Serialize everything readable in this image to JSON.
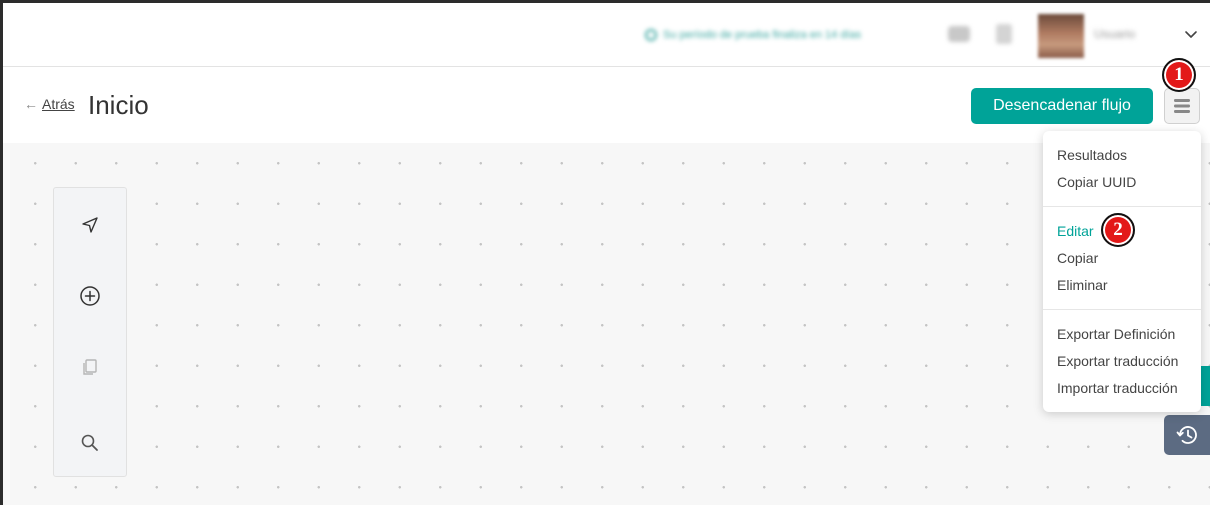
{
  "header": {
    "trial_banner_text": "Su período de prueba finaliza en 14 días",
    "user_name": "Usuario",
    "icons": [
      "info-icon",
      "help-icon",
      "bell-icon",
      "chevron-down-icon"
    ]
  },
  "titlebar": {
    "back_arrow": "←",
    "back_label": "Atrás",
    "page_title": "Inicio",
    "trigger_button_label": "Desencadenar flujo",
    "menu_icon": "hamburger-icon"
  },
  "toolbar": {
    "tools": [
      "navigate-icon",
      "add-circle-icon",
      "copy-icon",
      "search-icon"
    ]
  },
  "menu": {
    "group1": [
      "Resultados",
      "Copiar UUID"
    ],
    "group2": [
      "Editar",
      "Copiar",
      "Eliminar"
    ],
    "group3": [
      "Exportar Definición",
      "Exportar traducción",
      "Importar traducción"
    ],
    "active_item": "Editar"
  },
  "markers": {
    "one": "1",
    "two": "2"
  },
  "colors": {
    "accent": "#00a398",
    "marker_red": "#e31818",
    "history_button": "#5c6b82"
  }
}
